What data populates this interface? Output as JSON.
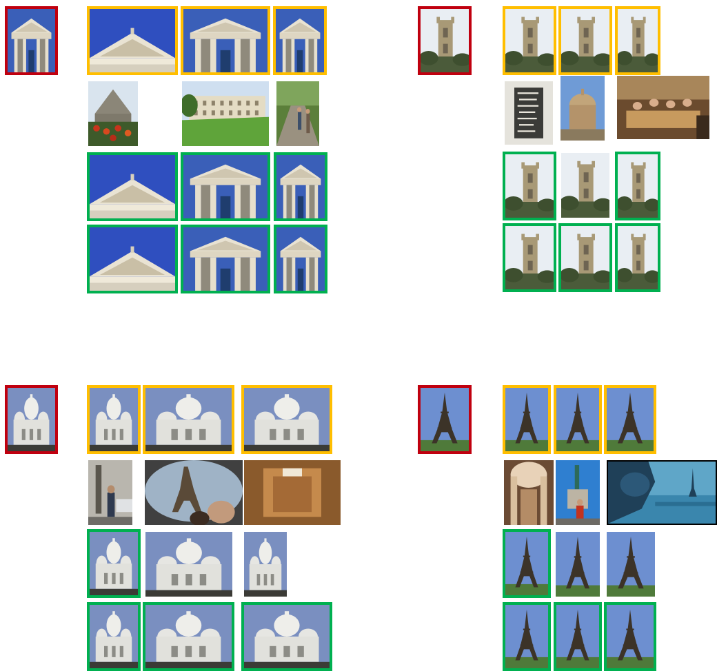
{
  "colors": {
    "query_border": "#c0000f",
    "positive_border": "#ffbe00",
    "correct_border": "#00b050",
    "background": "#ffffff"
  },
  "panels": [
    {
      "query": {
        "subject": "ashmolean-portico"
      },
      "rows": [
        {
          "border": "yellow",
          "subjects": [
            "pediment-closeup",
            "portico-full",
            "portico-person"
          ]
        },
        {
          "border": "none",
          "subjects": [
            "stone-chapel-flowers",
            "college-lawn",
            "towpath-walkers"
          ]
        },
        {
          "border": "green",
          "subjects": [
            "pediment-closeup",
            "portico-full",
            "portico-person"
          ]
        },
        {
          "border": "green",
          "subjects": [
            "pediment-closeup",
            "portico-full",
            "portico-person"
          ]
        }
      ]
    },
    {
      "query": {
        "subject": "magdalen-tower"
      },
      "rows": [
        {
          "border": "yellow",
          "subjects": [
            "tower-gray-sky",
            "tower-blue-sky",
            "tower-street"
          ]
        },
        {
          "border": "none",
          "subjects": [
            "chalkboard-sign",
            "radcliffe-camera",
            "dinner-group"
          ]
        },
        {
          "border": "mixed",
          "subjects": [
            "tower-gray-sky",
            "tower-white-sky",
            "tower-street"
          ]
        },
        {
          "border": "green",
          "subjects": [
            "tower-gray-sky",
            "tower-blue-sky",
            "tower-street"
          ]
        }
      ]
    },
    {
      "query": {
        "subject": "sacre-coeur"
      },
      "rows": [
        {
          "border": "yellow",
          "subjects": [
            "basilica-front",
            "basilica-blue",
            "basilica-cloudy"
          ]
        },
        {
          "border": "none",
          "subjects": [
            "street-statue",
            "eiffel-fisheye",
            "tomb-interior"
          ]
        },
        {
          "border": "mixed",
          "subjects": [
            "basilica-front",
            "basilica-cloudy",
            "basilica-trees"
          ]
        },
        {
          "border": "green",
          "subjects": [
            "basilica-front",
            "basilica-blue",
            "basilica-cloudy"
          ]
        }
      ]
    },
    {
      "query": {
        "subject": "eiffel-tower"
      },
      "rows": [
        {
          "border": "yellow",
          "subjects": [
            "eiffel-dusk",
            "eiffel-blue",
            "eiffel-clouds"
          ]
        },
        {
          "border": "none",
          "subjects": [
            "pantheon-interior",
            "republique-statue",
            "gargoyle-paris"
          ]
        },
        {
          "border": "mixed",
          "subjects": [
            "eiffel-dusk",
            "eiffel-blue",
            "eiffel-clouds"
          ]
        },
        {
          "border": "green",
          "subjects": [
            "eiffel-dusk",
            "eiffel-blue",
            "eiffel-clouds"
          ]
        }
      ]
    }
  ]
}
